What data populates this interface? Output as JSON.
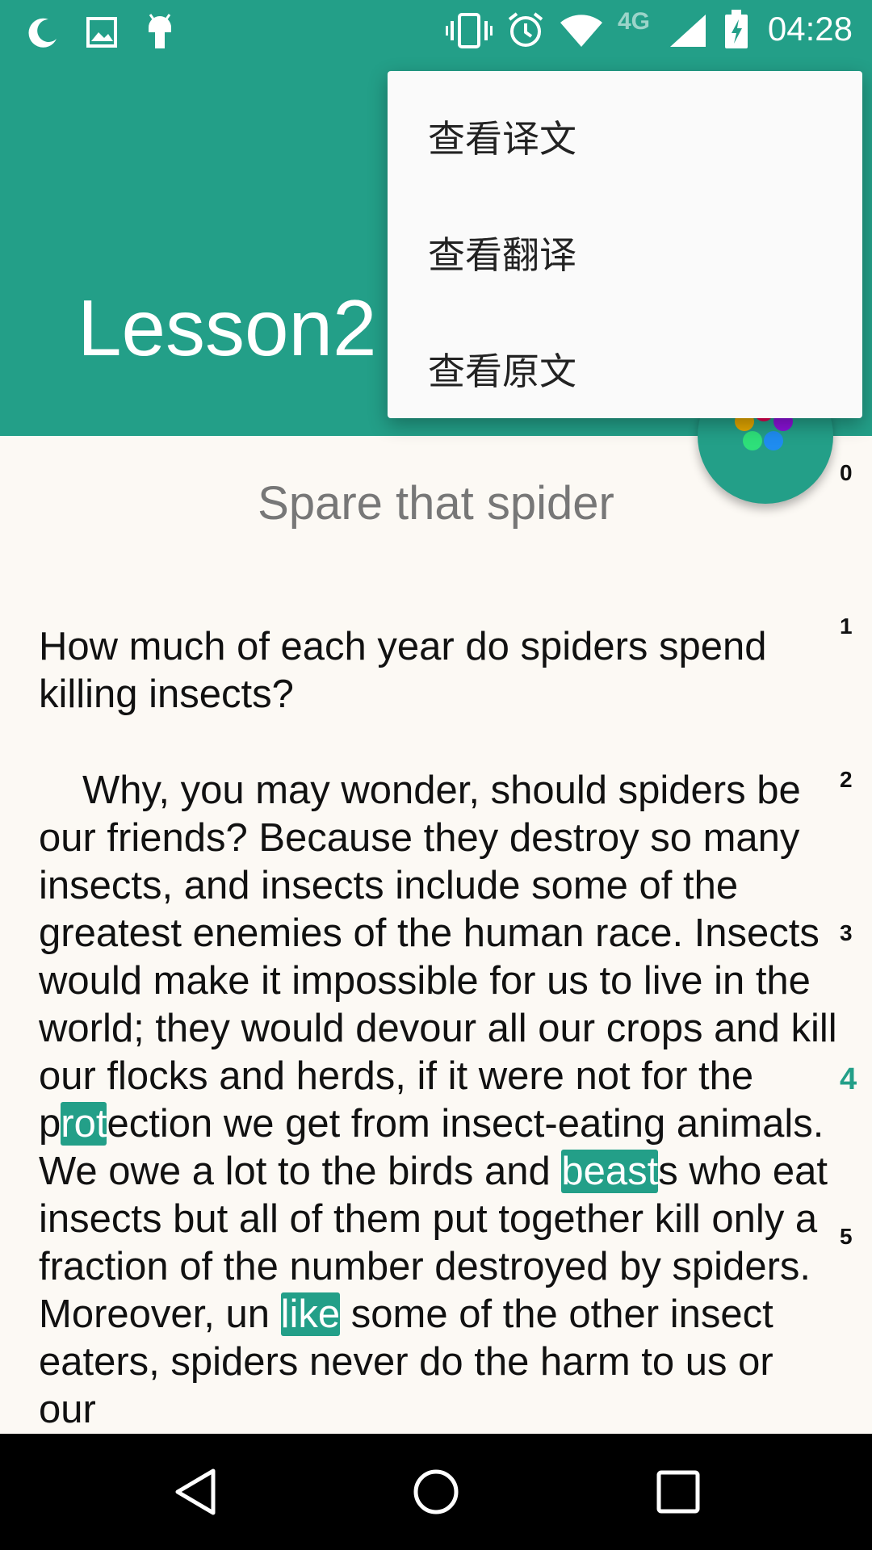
{
  "status_bar": {
    "time": "04:28",
    "network": "4G",
    "icons": [
      "moon-icon",
      "image-icon",
      "android-icon",
      "vibrate-icon",
      "alarm-icon",
      "wifi-icon",
      "signal-icon",
      "battery-charging-icon"
    ]
  },
  "header": {
    "title": "Lesson2",
    "accent_color": "#239f88"
  },
  "menu": {
    "items": [
      {
        "label": "查看译文"
      },
      {
        "label": "查看翻译"
      },
      {
        "label": "查看原文"
      }
    ]
  },
  "article": {
    "title": "Spare that spider",
    "paragraph_numbers": [
      "0",
      "1",
      "2",
      "3",
      "4",
      "5"
    ],
    "active_paragraph": "4",
    "question": "How much of each year do spiders spend killing insects?",
    "body": {
      "s1": "Why, you may wonder, should spiders be our friends? Because they destroy so many insects, and insects include some of the greatest enemies of the human race. Insects would make it impossible for us to live in the world; they would devour all our crops and kill our flocks and herds, if it were not for the p",
      "h1": "rot",
      "s2": "ection we get from insect-eating animals. We owe a lot to the birds and ",
      "h2": "beast",
      "s3": "s who eat insects but all of them put together kill only a fraction of the number destroyed by spiders. Moreover, un ",
      "h3": "like",
      "s4": " some of the other insect eaters, spiders never do the harm to us or our"
    }
  },
  "nav_bar": {
    "icons": [
      "back-icon",
      "home-icon",
      "recents-icon"
    ]
  }
}
